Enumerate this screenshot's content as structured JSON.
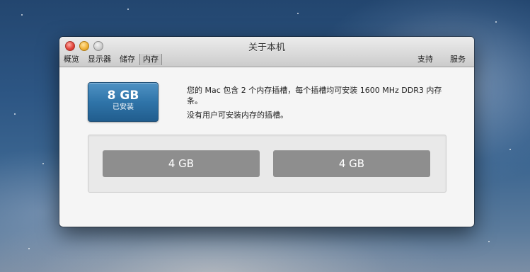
{
  "window": {
    "title": "关于本机"
  },
  "tabs": [
    {
      "label": "概览"
    },
    {
      "label": "显示器"
    },
    {
      "label": "储存"
    },
    {
      "label": "内存"
    }
  ],
  "tabs_right": [
    {
      "label": "支持"
    },
    {
      "label": "服务"
    }
  ],
  "memory": {
    "total_size": "8 GB",
    "installed_label": "已安装",
    "description": "您的 Mac 包含 2 个内存插槽，每个插槽均可安装 1600 MHz DDR3 内存条。",
    "note": "没有用户可安装内存的插槽。",
    "slots": [
      {
        "size": "4 GB"
      },
      {
        "size": "4 GB"
      }
    ]
  }
}
